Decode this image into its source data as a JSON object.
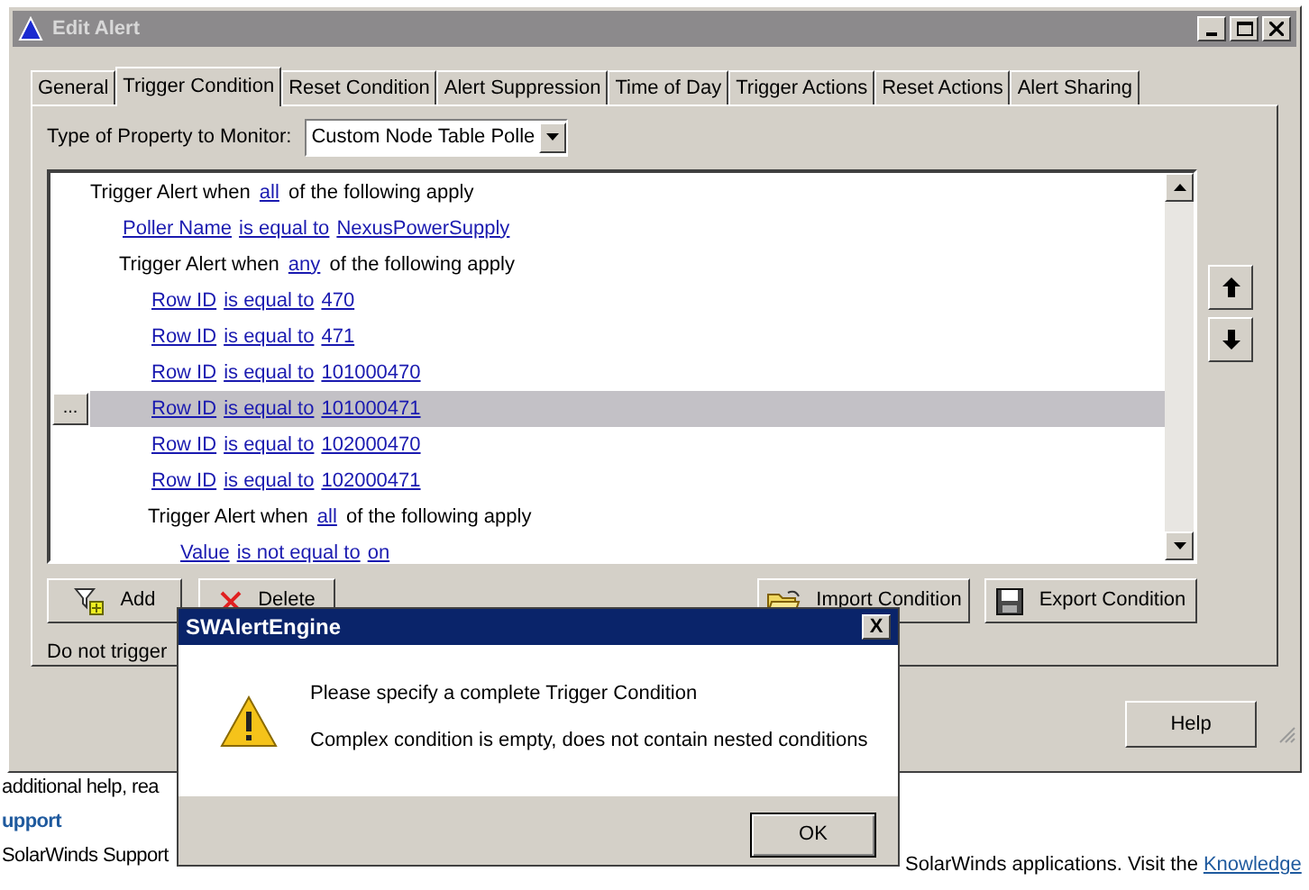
{
  "background_page": {
    "texts": [
      {
        "text": "additional help, rea",
        "kind": "plain"
      },
      {
        "text": "upport",
        "kind": "heading"
      },
      {
        "text": "SolarWinds Support",
        "kind": "plain"
      }
    ],
    "footer_text": "SolarWinds applications. Visit the",
    "footer_link": "Knowledge"
  },
  "window": {
    "title": "Edit Alert",
    "tabs": [
      {
        "label": "General",
        "selected": false
      },
      {
        "label": "Trigger Condition",
        "selected": true
      },
      {
        "label": "Reset Condition",
        "selected": false
      },
      {
        "label": "Alert Suppression",
        "selected": false
      },
      {
        "label": "Time of Day",
        "selected": false
      },
      {
        "label": "Trigger Actions",
        "selected": false
      },
      {
        "label": "Reset Actions",
        "selected": false
      },
      {
        "label": "Alert Sharing",
        "selected": false
      }
    ],
    "property_label": "Type of Property to Monitor:",
    "property_value": "Custom Node Table Polle",
    "conditions": [
      {
        "selected": false,
        "parts": [
          {
            "text": "Trigger Alert when ",
            "link": false
          },
          {
            "text": "all",
            "link": true
          },
          {
            "text": " of the following apply",
            "link": false
          }
        ],
        "children": [
          {
            "selected": false,
            "parts": [
              {
                "text": "Poller Name",
                "link": true
              },
              {
                "text": "is equal to",
                "link": true
              },
              {
                "text": "NexusPowerSupply",
                "link": true
              }
            ]
          },
          {
            "selected": false,
            "parts": [
              {
                "text": "Trigger Alert when ",
                "link": false
              },
              {
                "text": "any",
                "link": true
              },
              {
                "text": " of the following apply",
                "link": false
              }
            ],
            "children": [
              {
                "selected": false,
                "parts": [
                  {
                    "text": "Row ID",
                    "link": true
                  },
                  {
                    "text": "is equal to",
                    "link": true
                  },
                  {
                    "text": "470",
                    "link": true
                  }
                ]
              },
              {
                "selected": false,
                "parts": [
                  {
                    "text": "Row ID",
                    "link": true
                  },
                  {
                    "text": "is equal to",
                    "link": true
                  },
                  {
                    "text": "471",
                    "link": true
                  }
                ]
              },
              {
                "selected": false,
                "parts": [
                  {
                    "text": "Row ID",
                    "link": true
                  },
                  {
                    "text": "is equal to",
                    "link": true
                  },
                  {
                    "text": "101000470",
                    "link": true
                  }
                ]
              },
              {
                "selected": true,
                "parts": [
                  {
                    "text": "Row ID",
                    "link": true
                  },
                  {
                    "text": "is equal to",
                    "link": true
                  },
                  {
                    "text": "101000471",
                    "link": true
                  }
                ]
              },
              {
                "selected": false,
                "parts": [
                  {
                    "text": "Row ID",
                    "link": true
                  },
                  {
                    "text": "is equal to",
                    "link": true
                  },
                  {
                    "text": "102000470",
                    "link": true
                  }
                ]
              },
              {
                "selected": false,
                "parts": [
                  {
                    "text": "Row ID",
                    "link": true
                  },
                  {
                    "text": "is equal to",
                    "link": true
                  },
                  {
                    "text": "102000471",
                    "link": true
                  }
                ]
              },
              {
                "selected": false,
                "parts": [
                  {
                    "text": "Trigger Alert when ",
                    "link": false
                  },
                  {
                    "text": "all",
                    "link": true
                  },
                  {
                    "text": " of the following apply",
                    "link": false
                  }
                ],
                "children": [
                  {
                    "selected": false,
                    "parts": [
                      {
                        "text": "Value",
                        "link": true
                      },
                      {
                        "text": "is not equal to",
                        "link": true
                      },
                      {
                        "text": "on",
                        "link": true
                      }
                    ]
                  }
                ]
              }
            ]
          }
        ]
      }
    ],
    "row_button": "...",
    "buttons": [
      {
        "label": "Add",
        "kind": "add"
      },
      {
        "label": "Delete",
        "kind": "delete"
      },
      {
        "label": "Import Condition",
        "kind": "import"
      },
      {
        "label": "Export Condition",
        "kind": "export"
      }
    ],
    "note": "Do not trigger",
    "help_button": "Help"
  },
  "dialog": {
    "title": "SWAlertEngine",
    "close": "X",
    "message": "Please specify a complete Trigger Condition",
    "detail": "Complex condition is empty, does not contain nested conditions",
    "ok_button": "OK"
  }
}
